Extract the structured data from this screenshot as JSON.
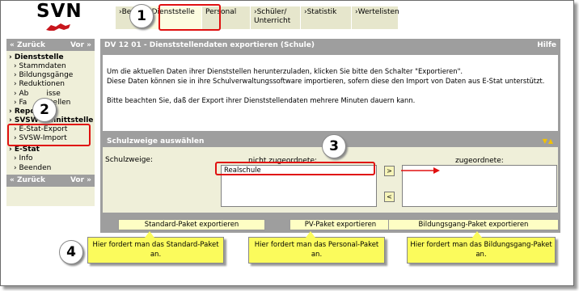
{
  "logo": {
    "text": "SVN"
  },
  "tabs": [
    {
      "label": "›Be",
      "active": false
    },
    {
      "label": "›Dienststelle",
      "active": true
    },
    {
      "label": "Personal",
      "active": false
    },
    {
      "label": "›Schüler/\nUnterricht",
      "active": false
    },
    {
      "label": "›Statistik",
      "active": false
    },
    {
      "label": "›Wertelisten",
      "active": false
    }
  ],
  "sidebar": {
    "nav_back": "« Zurück",
    "nav_forward": "Vor »",
    "sections": [
      {
        "title": "› Dienststelle",
        "items": [
          "› Stammdaten",
          "› Bildungsgänge",
          "› Reduktionen",
          "› Ab",
          "› Fa"
        ]
      },
      {
        "title": "› Repo",
        "items": []
      },
      {
        "title": "› SVSW-Schnittstelle",
        "items": [
          "› E-Stat-Export",
          "› SVSW-Import"
        ]
      },
      {
        "title": "› E-Stat",
        "items": [
          "› Info",
          "› Beenden"
        ]
      }
    ],
    "partial_items": {
      "a": "isse",
      "b": "stellen"
    }
  },
  "main": {
    "title": "DV 12 01 - Dienststellendaten exportieren (Schule)",
    "help": "Hilfe",
    "info_line1": "Um die aktuellen Daten ihrer Dienststellen herunterzuladen, klicken Sie bitte den Schalter \"Exportieren\".",
    "info_line2": "Diese Daten können sie in ihre Schulverwaltungssoftware importieren, sofern diese den Import von Daten aus E-Stat unterstützt.",
    "info_line3": "Bitte beachten Sie, daß der Export ihrer Dienststellendaten mehrere Minuten dauern kann."
  },
  "schulzweige": {
    "header": "Schulzweige auswählen",
    "header_arrows": "▼▲",
    "label": "Schulzweige:",
    "left_label": "nicht zugeordnete:",
    "right_label": "zugeordnete:",
    "left_items": [
      "Realschule"
    ],
    "right_items": [],
    "btn_add": ">",
    "btn_remove": "<"
  },
  "export_buttons": [
    {
      "label": "Standard-Paket exportieren"
    },
    {
      "label": "PV-Paket exportieren"
    },
    {
      "label": "Bildungsgang-Paket exportieren"
    }
  ],
  "callouts": [
    {
      "text": "Hier fordert man das Standard-Paket an."
    },
    {
      "text": "Hier fordert man das Personal-Paket an."
    },
    {
      "text": "Hier fordert man das Bildungsgang-Paket an."
    }
  ],
  "markers": [
    "1",
    "2",
    "3",
    "4"
  ],
  "colors": {
    "highlight": "#e01010",
    "header_gray": "#9e9e9e",
    "panel_beige": "#efefd9",
    "button_yellow": "#fefec4",
    "callout_yellow": "#fbfb5c"
  }
}
